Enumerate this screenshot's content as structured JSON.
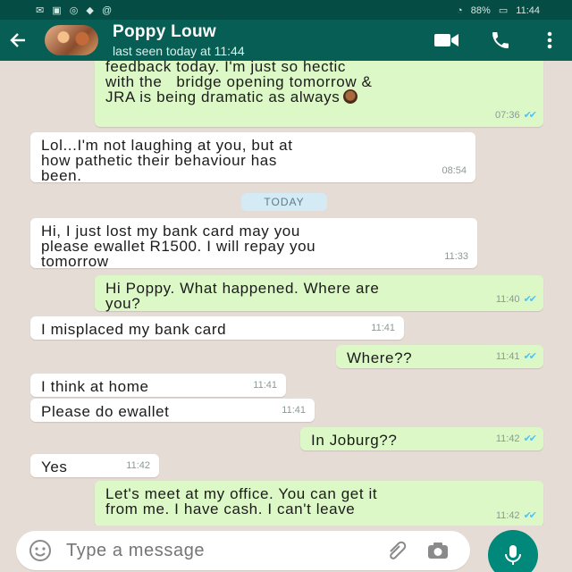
{
  "status_bar": {
    "battery": "88%",
    "time": "11:44"
  },
  "header": {
    "contact_name": "Poppy Louw",
    "contact_status": "last seen today at 11:44"
  },
  "chat": {
    "date_separator": "TODAY",
    "messages": [
      {
        "dir": "out",
        "text": "feedback today. I'm just so hectic\nwith the   bridge opening tomorrow &\nJRA is being dramatic as always",
        "time": "07:36",
        "ticks": true
      },
      {
        "dir": "in",
        "text": "Lol...I'm not laughing at you, but at\nhow pathetic their behaviour has\nbeen.",
        "time": "08:54"
      },
      {
        "dir": "in",
        "text": "Hi, I just lost my bank card may you\nplease ewallet R1500. I will repay you\ntomorrow",
        "time": "11:33"
      },
      {
        "dir": "out",
        "text": "Hi Poppy. What happened. Where are\nyou?",
        "time": "11:40",
        "ticks": true
      },
      {
        "dir": "in",
        "text": "I misplaced my bank card",
        "time": "11:41"
      },
      {
        "dir": "out",
        "text": "Where??",
        "time": "11:41",
        "ticks": true
      },
      {
        "dir": "in",
        "text": "I think at home",
        "time": "11:41"
      },
      {
        "dir": "in",
        "text": "Please do ewallet",
        "time": "11:41"
      },
      {
        "dir": "out",
        "text": "In Joburg??",
        "time": "11:42",
        "ticks": true
      },
      {
        "dir": "in",
        "text": "Yes",
        "time": "11:42"
      },
      {
        "dir": "out",
        "text": "Let's meet at my office. You can get it\nfrom me. I have cash. I can't leave",
        "time": "11:42",
        "ticks": true
      }
    ]
  },
  "composer": {
    "placeholder": "Type a message"
  },
  "colors": {
    "header": "#075e54",
    "outgoing_bubble": "#dcf8c6",
    "incoming_bubble": "#ffffff",
    "background": "#e5ddd5",
    "mic_button": "#00897b"
  }
}
